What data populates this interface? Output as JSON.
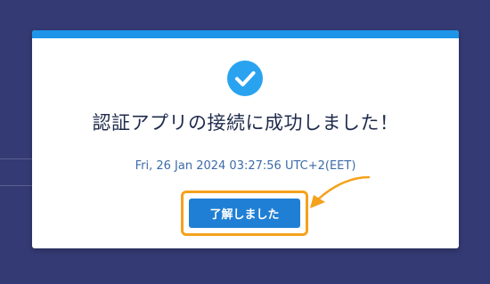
{
  "dialog": {
    "title": "認証アプリの接続に成功しました！",
    "timestamp": "Fri, 26 Jan 2024 03:27:56 UTC+2(EET)",
    "ok_label": "了解しました",
    "status_icon": "check-circle-icon"
  },
  "colors": {
    "backdrop": "#343a73",
    "accent_bar": "#1e95e8",
    "button": "#1f7fd4",
    "highlight": "#f5a11c",
    "title_text": "#1f2b4c",
    "timestamp_text": "#3c6ba8"
  }
}
